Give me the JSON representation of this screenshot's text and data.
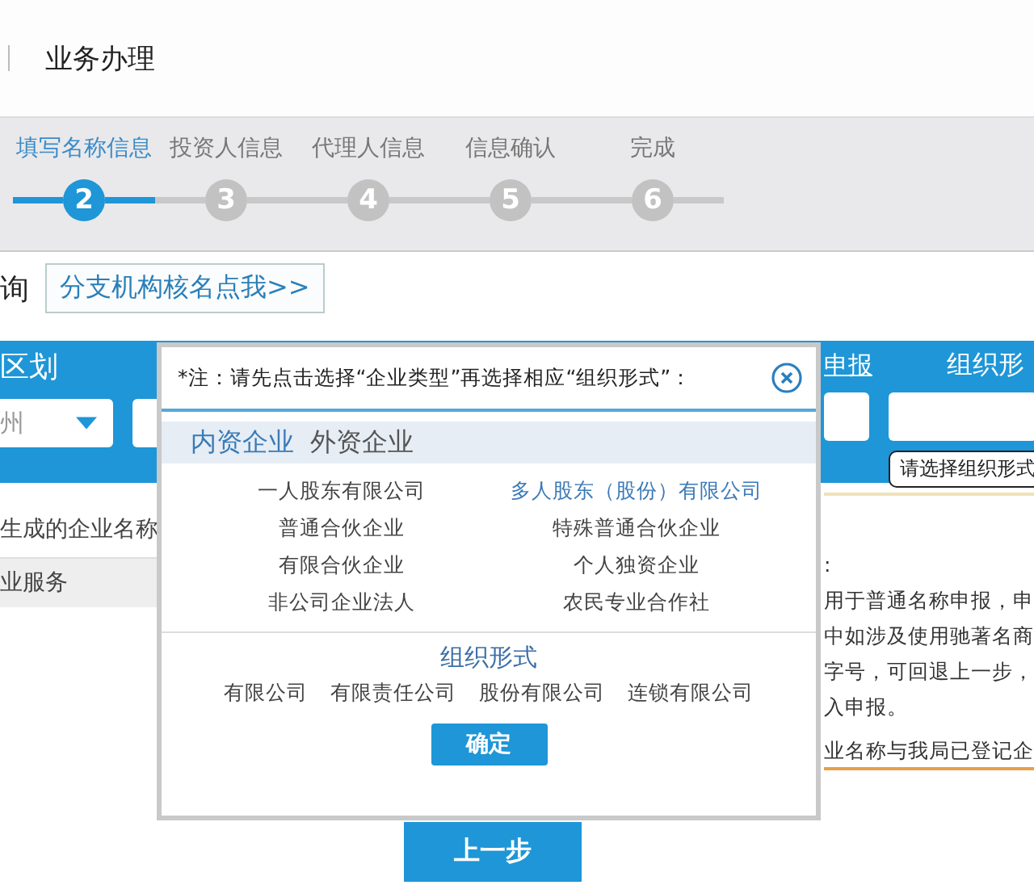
{
  "header": {
    "title": "业务办理"
  },
  "steps": [
    {
      "label": "填写名称信息",
      "number": "2",
      "selected": true
    },
    {
      "label": "投资人信息",
      "number": "3",
      "selected": false
    },
    {
      "label": "代理人信息",
      "number": "4",
      "selected": false
    },
    {
      "label": "信息确认",
      "number": "5",
      "selected": false
    },
    {
      "label": "完成",
      "number": "6",
      "selected": false
    }
  ],
  "query": {
    "label": "询",
    "link": "分支机构核名点我>>"
  },
  "form_band": {
    "region_label": "区划",
    "region_value": "州",
    "report_link": "申报",
    "form_label": "组织形",
    "form_tooltip": "请选择组织形式"
  },
  "name_section": {
    "label": "生成的企业名称",
    "row": "业服务"
  },
  "notes": [
    ":",
    "用于普通名称申报，申",
    "中如涉及使用驰著名商",
    "字号，可回退上一步，",
    "入申报。",
    "业名称与我局已登记企"
  ],
  "dialog": {
    "note": "*注：请先点击选择“企业类型”再选择相应“组织形式”：",
    "tabs": [
      {
        "label": "内资企业",
        "selected": true
      },
      {
        "label": "外资企业",
        "selected": false
      }
    ],
    "types": [
      {
        "label": "一人股东有限公司",
        "selected": false
      },
      {
        "label": "多人股东（股份）有限公司",
        "selected": true
      },
      {
        "label": "普通合伙企业",
        "selected": false
      },
      {
        "label": "特殊普通合伙企业",
        "selected": false
      },
      {
        "label": "有限合伙企业",
        "selected": false
      },
      {
        "label": "个人独资企业",
        "selected": false
      },
      {
        "label": "非公司企业法人",
        "selected": false
      },
      {
        "label": "农民专业合作社",
        "selected": false
      }
    ],
    "form_title": "组织形式",
    "forms": [
      "有限公司",
      "有限责任公司",
      "股份有限公司",
      "连锁有限公司"
    ],
    "confirm": "确定"
  },
  "back_button": "上一步"
}
